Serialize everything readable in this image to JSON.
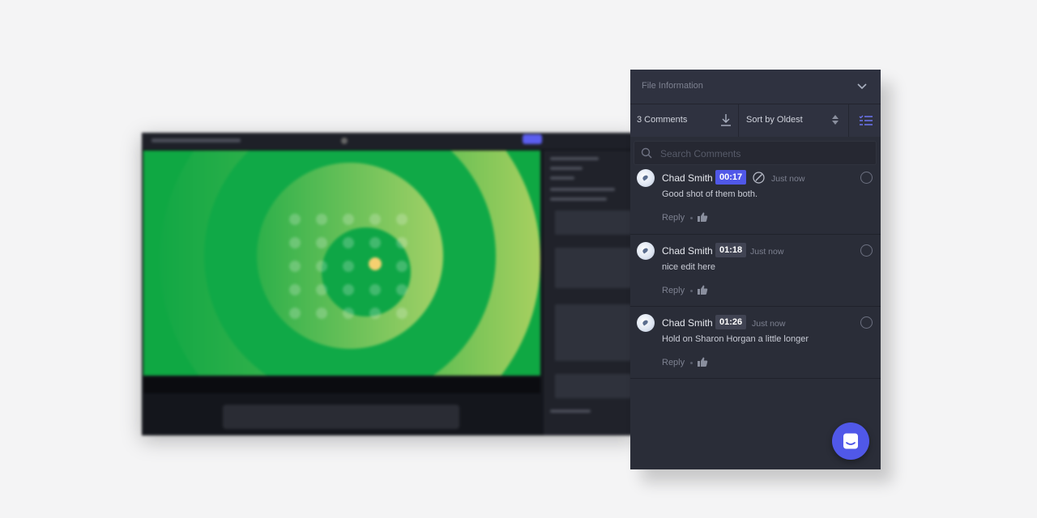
{
  "panel": {
    "file_info_label": "File Information",
    "comment_count_label": "3 Comments",
    "sort_label": "Sort by Oldest",
    "search_placeholder": "Search Comments",
    "accent_color": "#5058e8"
  },
  "comments": [
    {
      "author": "Chad Smith",
      "timecode": "00:17",
      "time_ago": "Just now",
      "text": "Good shot of them both.",
      "reply_label": "Reply",
      "has_drawing": true,
      "active": true
    },
    {
      "author": "Chad Smith",
      "timecode": "01:18",
      "time_ago": "Just now",
      "text": "nice edit here",
      "reply_label": "Reply",
      "has_drawing": false,
      "active": false
    },
    {
      "author": "Chad Smith",
      "timecode": "01:26",
      "time_ago": "Just now",
      "text": "Hold on Sharon Horgan a little longer",
      "reply_label": "Reply",
      "has_drawing": false,
      "active": false
    }
  ],
  "icons": [
    "chevron-down-icon",
    "download-icon",
    "sort-arrows-icon",
    "checklist-icon",
    "search-icon",
    "drawing-icon",
    "thumbs-up-icon",
    "chat-icon"
  ]
}
